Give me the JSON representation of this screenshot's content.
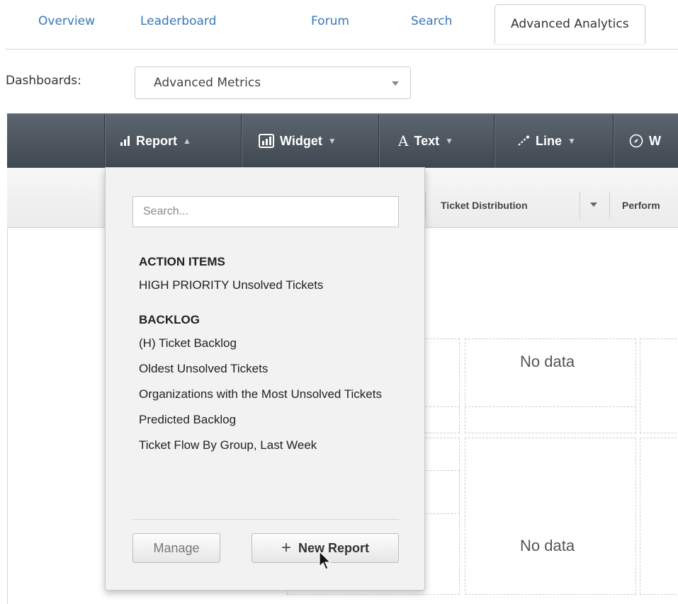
{
  "nav": {
    "tabs": [
      {
        "label": "Overview"
      },
      {
        "label": "Leaderboard"
      },
      {
        "label": "Forum"
      },
      {
        "label": "Search"
      },
      {
        "label": "Advanced Analytics",
        "active": true
      }
    ]
  },
  "dashboards": {
    "label": "Dashboards:",
    "selected": "Advanced Metrics"
  },
  "toolbar": {
    "items": [
      {
        "label": "Report",
        "arrow": "▲",
        "icon": "bar-chart-icon"
      },
      {
        "label": "Widget",
        "arrow": "▼",
        "icon": "widget-icon"
      },
      {
        "label": "Text",
        "arrow": "▼",
        "icon": "text-icon"
      },
      {
        "label": "Line",
        "arrow": "▼",
        "icon": "line-icon"
      },
      {
        "label": "W",
        "icon": "compass-icon"
      }
    ]
  },
  "columns": {
    "ticket_distribution": "Ticket Distribution",
    "performance_partial": "Perform"
  },
  "grid": {
    "no_data_1": "No data",
    "no_data_2": "No data"
  },
  "report_menu": {
    "search_placeholder": "Search...",
    "groups": [
      {
        "title": "ACTION ITEMS",
        "items": [
          "HIGH PRIORITY Unsolved Tickets"
        ]
      },
      {
        "title": "BACKLOG",
        "items": [
          "(H) Ticket Backlog",
          "Oldest Unsolved Tickets",
          "Organizations with the Most Unsolved Tickets",
          "Predicted Backlog",
          "Ticket Flow By Group, Last Week"
        ]
      }
    ],
    "manage_label": "Manage",
    "new_report_label": "New Report",
    "plus_symbol": "+"
  },
  "colors": {
    "link": "#3a78b5",
    "toolbar_dark": "#3f474f",
    "popover_bg": "#f2f2f2"
  }
}
